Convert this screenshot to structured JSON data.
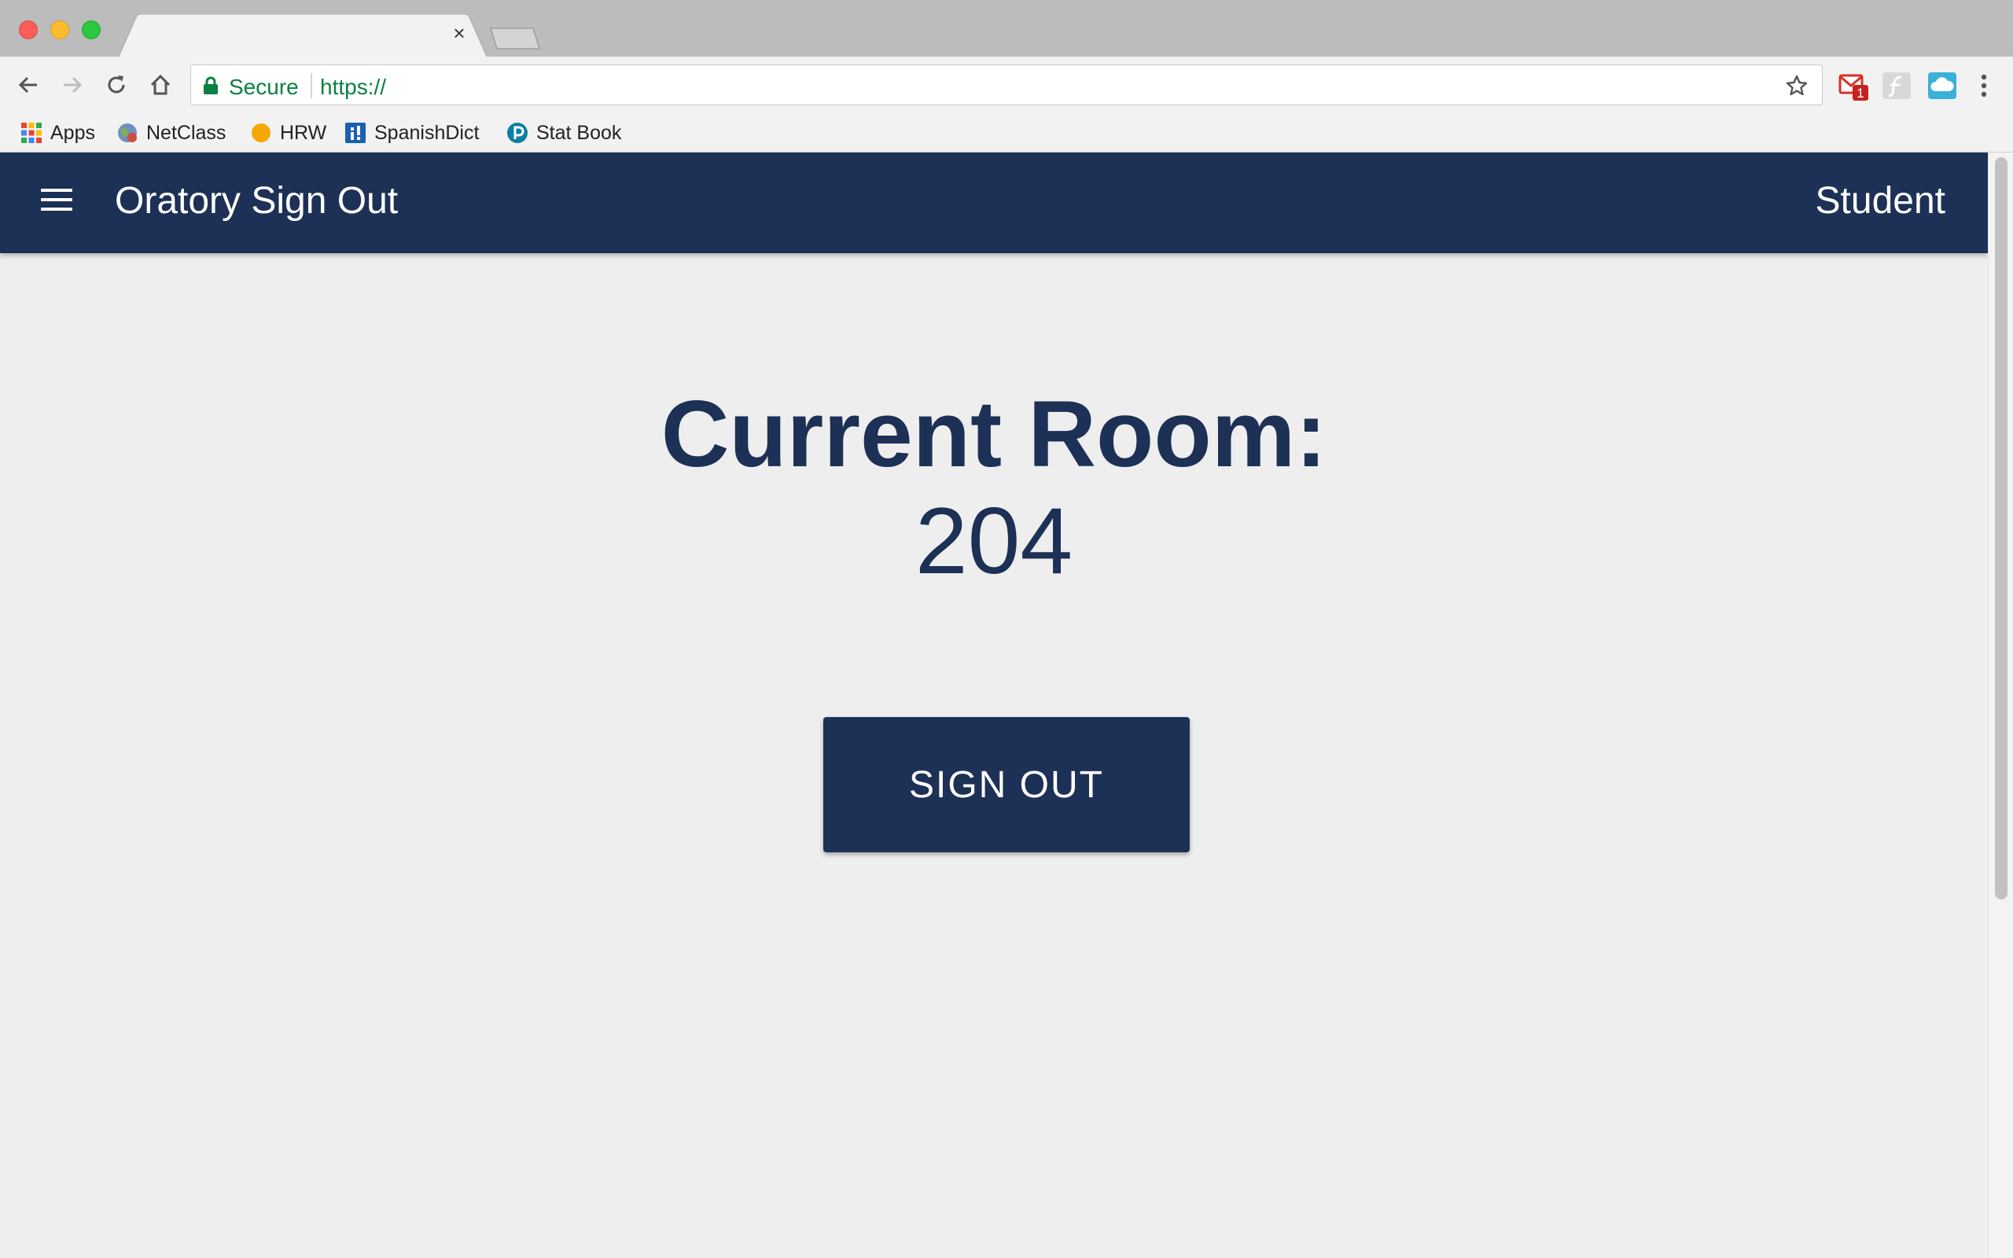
{
  "browser": {
    "tab_close_glyph": "×",
    "omnibox": {
      "secure_label": "Secure",
      "url": "https://"
    },
    "extensions": {
      "gmail_badge": "1"
    },
    "bookmarks": [
      {
        "label": "Apps",
        "icon": "apps-grid-icon"
      },
      {
        "label": "NetClass",
        "icon": "globe-icon"
      },
      {
        "label": "HRW",
        "icon": "orange-circle-icon"
      },
      {
        "label": "SpanishDict",
        "icon": "spanishdict-icon"
      },
      {
        "label": "Stat Book",
        "icon": "pearson-icon"
      }
    ]
  },
  "app": {
    "title": "Oratory Sign Out",
    "role": "Student",
    "room_heading": "Current Room:",
    "room_number": "204",
    "signout_label": "SIGN OUT",
    "colors": {
      "primary": "#1d3056",
      "background": "#eeeeee"
    }
  }
}
